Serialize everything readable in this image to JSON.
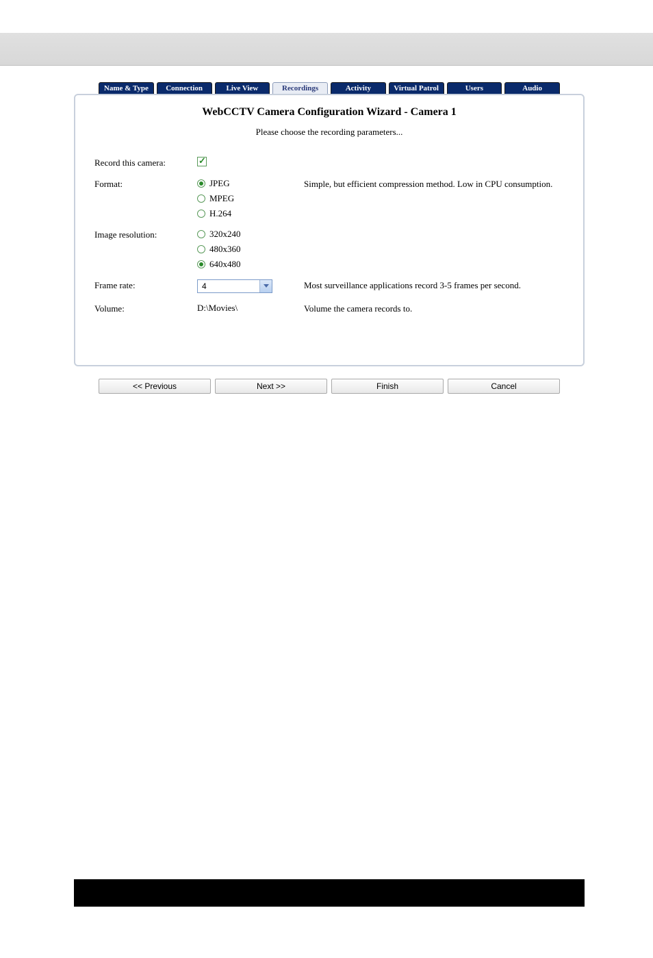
{
  "tabs": {
    "name_type": "Name & Type",
    "connection": "Connection",
    "live_view": "Live View",
    "recordings": "Recordings",
    "activity": "Activity",
    "virtual_patrol": "Virtual Patrol",
    "users": "Users",
    "audio": "Audio"
  },
  "wizard": {
    "title": "WebCCTV Camera Configuration Wizard - Camera 1",
    "subtitle": "Please choose the recording parameters..."
  },
  "labels": {
    "record": "Record this camera:",
    "format": "Format:",
    "resolution": "Image resolution:",
    "frame_rate": "Frame rate:",
    "volume": "Volume:"
  },
  "format": {
    "jpeg": "JPEG",
    "mpeg": "MPEG",
    "h264": "H.264",
    "desc": "Simple, but efficient compression method. Low in CPU consumption."
  },
  "resolution": {
    "r1": "320x240",
    "r2": "480x360",
    "r3": "640x480"
  },
  "frame_rate": {
    "value": "4",
    "desc": "Most surveillance applications record 3-5 frames per second."
  },
  "volume": {
    "value": "D:\\Movies\\",
    "desc": "Volume the camera records to."
  },
  "buttons": {
    "prev": "<< Previous",
    "next": "Next >>",
    "finish": "Finish",
    "cancel": "Cancel"
  }
}
